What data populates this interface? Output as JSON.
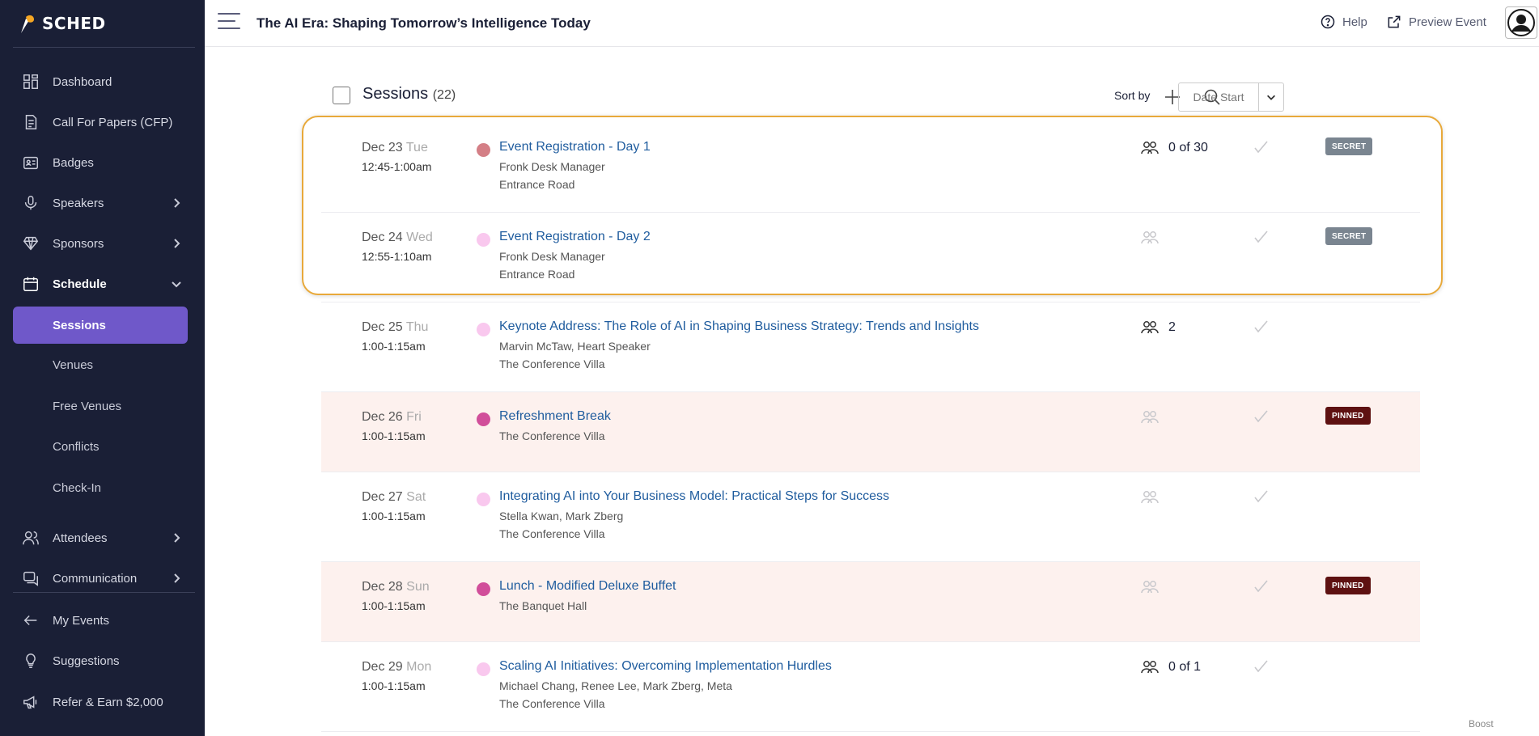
{
  "app": {
    "logo_text": "SCHED",
    "event_title": "The AI Era: Shaping Tomorrow’s Intelligence Today"
  },
  "topbar": {
    "help": "Help",
    "preview": "Preview Event"
  },
  "sidebar": {
    "items": [
      {
        "label": "Dashboard",
        "icon": "dashboard-icon"
      },
      {
        "label": "Call For Papers (CFP)",
        "icon": "document-icon"
      },
      {
        "label": "Badges",
        "icon": "badge-icon"
      },
      {
        "label": "Speakers",
        "icon": "microphone-icon"
      },
      {
        "label": "Sponsors",
        "icon": "diamond-icon"
      },
      {
        "label": "Schedule",
        "icon": "calendar-icon"
      }
    ],
    "schedule_sub": [
      "Sessions",
      "Venues",
      "Free Venues",
      "Conflicts",
      "Check-In"
    ],
    "items2": [
      {
        "label": "Attendees",
        "icon": "people-icon"
      },
      {
        "label": "Communication",
        "icon": "chat-icon"
      }
    ],
    "items3": [
      {
        "label": "My Events",
        "icon": "arrow-left-icon"
      },
      {
        "label": "Suggestions",
        "icon": "lightbulb-icon"
      },
      {
        "label": "Refer & Earn $2,000",
        "icon": "megaphone-icon"
      }
    ]
  },
  "sessions": {
    "title": "Sessions",
    "count": "(22)",
    "sort_label": "Sort by",
    "sort_value": "Date Start",
    "rows": [
      {
        "date": "Dec 23",
        "dow": "Tue",
        "time": "12:45-1:00am",
        "title": "Event Registration - Day 1",
        "line1": "Fronk Desk Manager",
        "line2": "Entrance Road",
        "capacity": "0 of 30",
        "badge": "SECRET",
        "dot": "#d47f86",
        "pinned": false
      },
      {
        "date": "Dec 24",
        "dow": "Wed",
        "time": "12:55-1:10am",
        "title": "Event Registration - Day 2",
        "line1": "Fronk Desk Manager",
        "line2": "Entrance Road",
        "capacity": "",
        "badge": "SECRET",
        "dot": "#f9c8ee",
        "pinned": false
      },
      {
        "date": "Dec 25",
        "dow": "Thu",
        "time": "1:00-1:15am",
        "title": "Keynote Address: The Role of AI in Shaping Business Strategy: Trends and Insights",
        "line1": "Marvin McTaw, Heart Speaker",
        "line2": "The Conference Villa",
        "capacity": "2",
        "badge": "",
        "dot": "#f9c8ee",
        "pinned": false
      },
      {
        "date": "Dec 26",
        "dow": "Fri",
        "time": "1:00-1:15am",
        "title": "Refreshment Break",
        "line1": "The Conference Villa",
        "line2": "",
        "capacity": "",
        "badge": "PINNED",
        "dot": "#d14e9a",
        "pinned": true
      },
      {
        "date": "Dec 27",
        "dow": "Sat",
        "time": "1:00-1:15am",
        "title": "Integrating AI into Your Business Model: Practical Steps for Success",
        "line1": "Stella Kwan, Mark Zberg",
        "line2": "The Conference Villa",
        "capacity": "",
        "badge": "",
        "dot": "#f9c8ee",
        "pinned": false
      },
      {
        "date": "Dec 28",
        "dow": "Sun",
        "time": "1:00-1:15am",
        "title": "Lunch - Modified Deluxe Buffet",
        "line1": "The Banquet Hall",
        "line2": "",
        "capacity": "",
        "badge": "PINNED",
        "dot": "#d14e9a",
        "pinned": true
      },
      {
        "date": "Dec 29",
        "dow": "Mon",
        "time": "1:00-1:15am",
        "title": "Scaling AI Initiatives: Overcoming Implementation Hurdles",
        "line1": "Michael Chang, Renee Lee, Mark Zberg, Meta",
        "line2": "The Conference Villa",
        "capacity": "0 of 1",
        "badge": "",
        "dot": "#f9c8ee",
        "pinned": false
      }
    ]
  },
  "footer": {
    "boost": "Boost"
  }
}
